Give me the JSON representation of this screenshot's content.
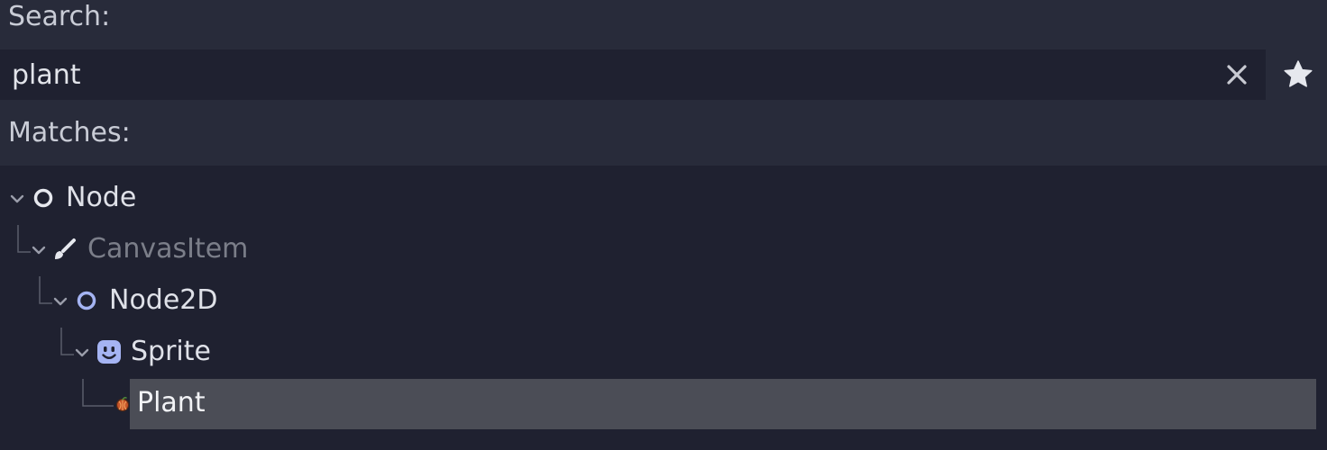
{
  "search": {
    "label": "Search:",
    "value": "plant"
  },
  "matches": {
    "label": "Matches:"
  },
  "tree": {
    "items": [
      {
        "label": "Node",
        "icon": "node-circle-icon",
        "dimmed": false,
        "selected": false
      },
      {
        "label": "CanvasItem",
        "icon": "brush-icon",
        "dimmed": true,
        "selected": false
      },
      {
        "label": "Node2D",
        "icon": "node2d-circle-icon",
        "dimmed": false,
        "selected": false
      },
      {
        "label": "Sprite",
        "icon": "sprite-face-icon",
        "dimmed": false,
        "selected": false
      },
      {
        "label": "Plant",
        "icon": "plant-icon",
        "dimmed": false,
        "selected": true
      }
    ]
  },
  "colors": {
    "background": "#282b3a",
    "field": "#1f2130",
    "text": "#dfe1e8",
    "dim_text": "#7b7e89",
    "selection": "#4b4d56",
    "node2d_accent": "#a5b4f3",
    "plant_accent": "#e07a3a"
  }
}
